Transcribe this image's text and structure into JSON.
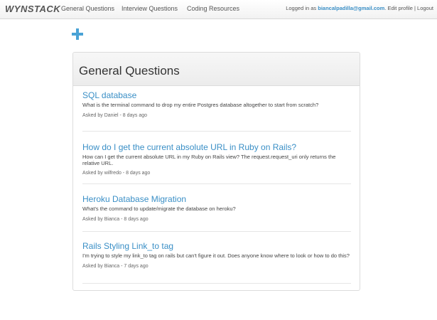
{
  "navbar": {
    "brand": "WYNSTACK",
    "links": [
      "General Questions",
      "Interview Questions",
      "Coding Resources"
    ],
    "logged_in_prefix": "Logged in as",
    "email": "biancalpadilla@gmail.com",
    "edit_profile": "Edit profile",
    "separator": "|",
    "logout": "Logout"
  },
  "add_button": {
    "icon": "plus-icon",
    "color": "#4aa3d6"
  },
  "panel": {
    "title": "General Questions"
  },
  "questions": [
    {
      "title": "SQL database",
      "body": "What is the terminal command to drop my entire Postgres database altogether to start from scratch?",
      "meta": "Asked by Daniel - 8 days ago"
    },
    {
      "title": "How do I get the current absolute URL in Ruby on Rails?",
      "body": "How can I get the current absolute URL in my Ruby on Rails view? The request.request_uri only returns the relative URL.",
      "meta": "Asked by wilfredo - 8 days ago"
    },
    {
      "title": "Heroku Database Migration",
      "body": "What's the command to update/migrate the database on heroku?",
      "meta": "Asked by Bianca - 8 days ago"
    },
    {
      "title": "Rails Styling Link_to tag",
      "body": "I'm trying to style my link_to tag on rails but can't figure it out. Does anyone know where to look or how to do this?",
      "meta": "Asked by Bianca - 7 days ago"
    }
  ]
}
